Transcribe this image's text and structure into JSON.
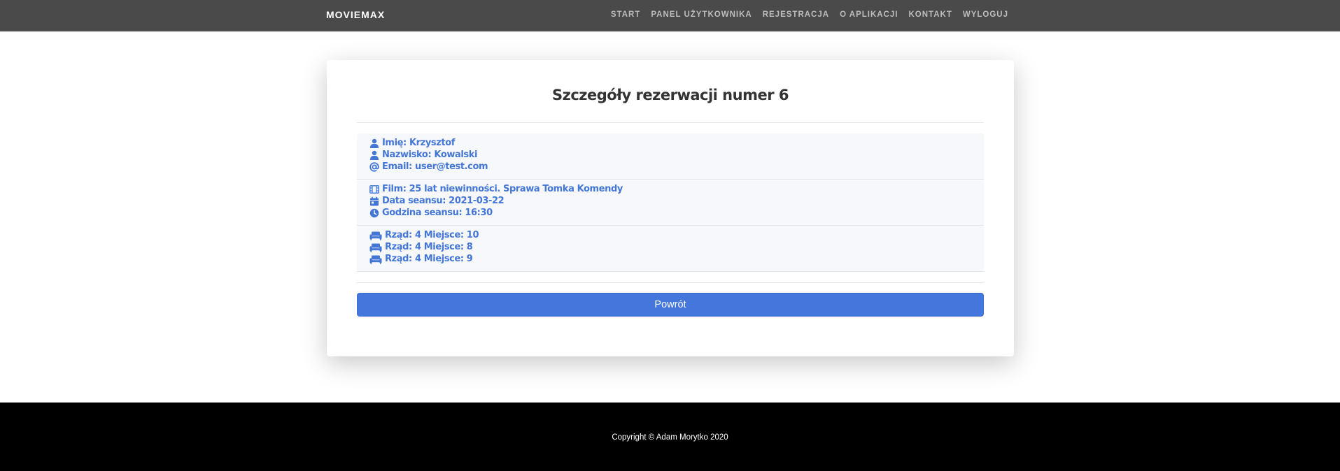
{
  "navbar": {
    "brand": "MOVIEMAX",
    "links": [
      "START",
      "PANEL UŻYTKOWNIKA",
      "REJESTRACJA",
      "O APLIKACJI",
      "KONTAKT",
      "WYLOGUJ"
    ]
  },
  "card": {
    "title": "Szczegóły rezerwacji numer 6",
    "groups": [
      {
        "rows": [
          {
            "icon": "user-icon",
            "text": "Imię: Krzysztof"
          },
          {
            "icon": "user-icon",
            "text": "Nazwisko: Kowalski"
          },
          {
            "icon": "at-icon",
            "text": "Email: user@test.com"
          }
        ]
      },
      {
        "rows": [
          {
            "icon": "film-icon",
            "text": "Film: 25 lat niewinności. Sprawa Tomka Komendy"
          },
          {
            "icon": "calendar-icon",
            "text": "Data seansu: 2021-03-22"
          },
          {
            "icon": "clock-icon",
            "text": "Godzina seansu: 16:30"
          }
        ]
      },
      {
        "rows": [
          {
            "icon": "seat-icon",
            "text": "Rząd: 4 Miejsce: 10"
          },
          {
            "icon": "seat-icon",
            "text": "Rząd: 4 Miejsce: 8"
          },
          {
            "icon": "seat-icon",
            "text": "Rząd: 4 Miejsce: 9"
          }
        ]
      }
    ],
    "back_label": "Powrót"
  },
  "footer": {
    "copyright": "Copyright © Adam Morytko 2020"
  },
  "colors": {
    "navbar_bg": "#4a4a4a",
    "accent": "#4476dc",
    "footer_bg": "#000000"
  }
}
